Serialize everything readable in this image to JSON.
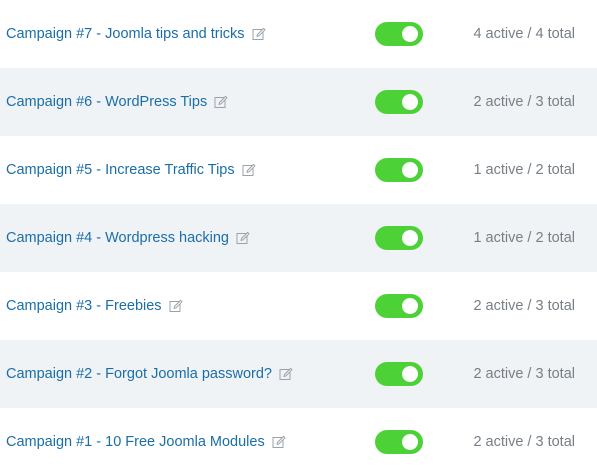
{
  "colors": {
    "link": "#1a6ea8",
    "toggle_on": "#4cd137",
    "row_alt_bg": "#f0f3f6",
    "counts_text": "#777f86"
  },
  "campaigns": [
    {
      "name": "Campaign #7 - Joomla tips and tricks",
      "enabled": true,
      "counts": "4 active / 4 total",
      "edit_icon": "edit-icon"
    },
    {
      "name": "Campaign #6 - WordPress Tips",
      "enabled": true,
      "counts": "2 active / 3 total",
      "edit_icon": "edit-icon"
    },
    {
      "name": "Campaign #5 - Increase Traffic Tips",
      "enabled": true,
      "counts": "1 active / 2 total",
      "edit_icon": "edit-icon"
    },
    {
      "name": "Campaign #4 - Wordpress hacking",
      "enabled": true,
      "counts": "1 active / 2 total",
      "edit_icon": "edit-icon"
    },
    {
      "name": "Campaign #3 - Freebies",
      "enabled": true,
      "counts": "2 active / 3 total",
      "edit_icon": "edit-icon"
    },
    {
      "name": "Campaign #2 - Forgot Joomla password?",
      "enabled": true,
      "counts": "2 active / 3 total",
      "edit_icon": "edit-icon"
    },
    {
      "name": "Campaign #1 - 10 Free Joomla Modules",
      "enabled": true,
      "counts": "2 active / 3 total",
      "edit_icon": "edit-icon"
    }
  ]
}
